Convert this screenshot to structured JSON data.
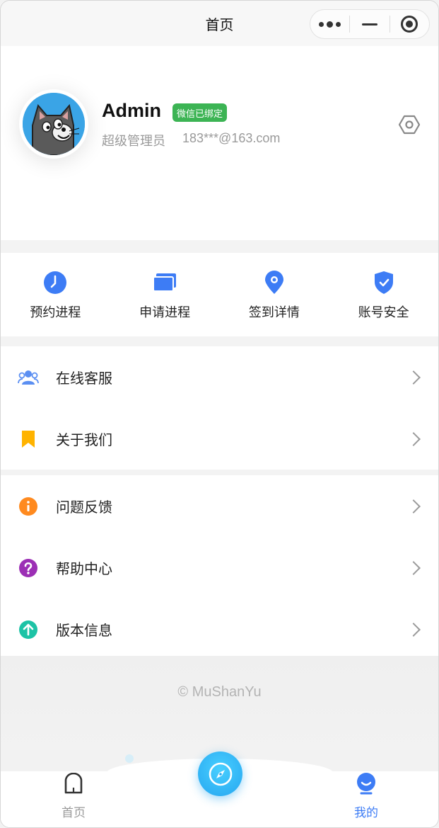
{
  "navbar": {
    "title": "首页",
    "capsule": {
      "more_icon": "more-dots-icon",
      "minimize_icon": "minimize-icon",
      "close_icon": "target-circle-icon"
    }
  },
  "profile": {
    "name": "Admin",
    "badge": "微信已绑定",
    "role": "超级管理员",
    "email": "183***@163.com",
    "avatar_icon": "cat-avatar",
    "settings_icon": "hexagon-settings-icon"
  },
  "quick": [
    {
      "label": "预约进程",
      "icon": "clock-icon",
      "color": "#3d7cf5"
    },
    {
      "label": "申请进程",
      "icon": "cards-icon",
      "color": "#3d7cf5"
    },
    {
      "label": "签到详情",
      "icon": "location-pin-icon",
      "color": "#3d7cf5"
    },
    {
      "label": "账号安全",
      "icon": "shield-check-icon",
      "color": "#3d7cf5"
    }
  ],
  "menu_group_1": [
    {
      "label": "在线客服",
      "icon": "people-icon",
      "color": "#5b8ff2"
    },
    {
      "label": "关于我们",
      "icon": "bookmark-icon",
      "color": "#ffb300"
    }
  ],
  "menu_group_2": [
    {
      "label": "问题反馈",
      "icon": "info-icon",
      "color": "#ff8a1f"
    },
    {
      "label": "帮助中心",
      "icon": "question-icon",
      "color": "#9c2fb5"
    },
    {
      "label": "版本信息",
      "icon": "arrow-up-icon",
      "color": "#1dc3a6"
    }
  ],
  "copyright": "© MuShanYu",
  "tabbar": {
    "home_label": "首页",
    "mine_label": "我的",
    "active_color": "#3d7cf5",
    "inactive_color": "#999999"
  }
}
